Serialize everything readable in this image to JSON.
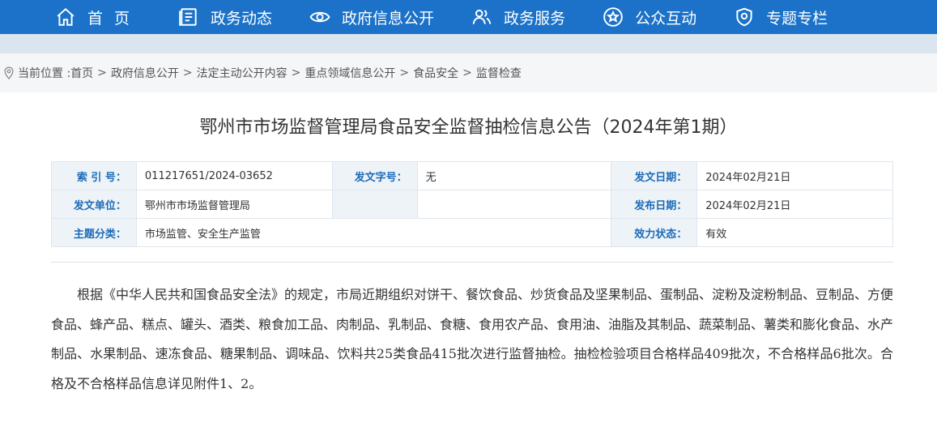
{
  "nav": {
    "items": [
      {
        "label": "首页",
        "icon": "home-icon"
      },
      {
        "label": "政务动态",
        "icon": "news-icon"
      },
      {
        "label": "政府信息公开",
        "icon": "eye-icon"
      },
      {
        "label": "政务服务",
        "icon": "users-icon"
      },
      {
        "label": "公众互动",
        "icon": "star-icon"
      },
      {
        "label": "专题专栏",
        "icon": "shield-icon"
      }
    ]
  },
  "breadcrumb": {
    "prefix": "当前位置 :",
    "items": [
      "首页",
      "政府信息公开",
      "法定主动公开内容",
      "重点领域信息公开",
      "食品安全",
      "监督检查"
    ],
    "separator": ">"
  },
  "article": {
    "title": "鄂州市市场监督管理局食品安全监督抽检信息公告（2024年第1期）",
    "meta": {
      "index_label": "索 引 号：",
      "index_value": "011217651/2024-03652",
      "doc_no_label": "发文字号：",
      "doc_no_value": "无",
      "issue_date_label": "发文日期：",
      "issue_date_value": "2024年02月21日",
      "issuer_label": "发文单位：",
      "issuer_value": "鄂州市市场监督管理局",
      "publish_date_label": "发布日期：",
      "publish_date_value": "2024年02月21日",
      "category_label": "主题分类：",
      "category_value": "市场监管、安全生产监管",
      "status_label": "效力状态：",
      "status_value": "有效"
    },
    "body": "根据《中华人民共和国食品安全法》的规定，市局近期组织对饼干、餐饮食品、炒货食品及坚果制品、蛋制品、淀粉及淀粉制品、豆制品、方便食品、蜂产品、糕点、罐头、酒类、粮食加工品、肉制品、乳制品、食糖、食用农产品、食用油、油脂及其制品、蔬菜制品、薯类和膨化食品、水产制品、水果制品、速冻食品、糖果制品、调味品、饮料共25类食品415批次进行监督抽检。抽检检验项目合格样品409批次，不合格样品6批次。合格及不合格样品信息详见附件1、2。"
  },
  "colors": {
    "nav_bg": "#1b72c8",
    "label_blue": "#1b6bb8",
    "label_bg": "#eef3f8"
  }
}
